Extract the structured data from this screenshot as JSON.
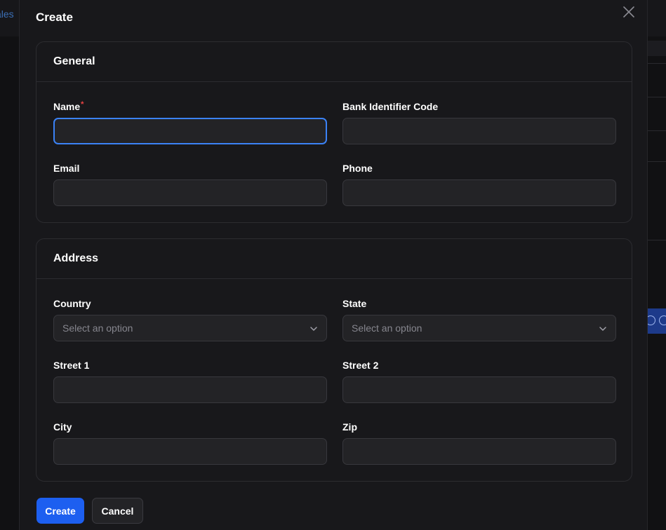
{
  "background": {
    "left_link_fragment": "ales"
  },
  "modal": {
    "title": "Create",
    "close_icon": "close-icon"
  },
  "general": {
    "title": "General",
    "name_label": "Name",
    "name_required_mark": "*",
    "name_value": "",
    "bic_label": "Bank Identifier Code",
    "bic_value": "",
    "email_label": "Email",
    "email_value": "",
    "phone_label": "Phone",
    "phone_value": ""
  },
  "address": {
    "title": "Address",
    "country_label": "Country",
    "country_placeholder": "Select an option",
    "state_label": "State",
    "state_placeholder": "Select an option",
    "street1_label": "Street 1",
    "street1_value": "",
    "street2_label": "Street 2",
    "street2_value": "",
    "city_label": "City",
    "city_value": "",
    "zip_label": "Zip",
    "zip_value": ""
  },
  "actions": {
    "create_label": "Create",
    "cancel_label": "Cancel"
  },
  "colors": {
    "accent": "#1d5ff0",
    "focus_ring": "#3b82f6",
    "required": "#ef4444",
    "surface": "#18181b",
    "input_bg": "#232326"
  }
}
